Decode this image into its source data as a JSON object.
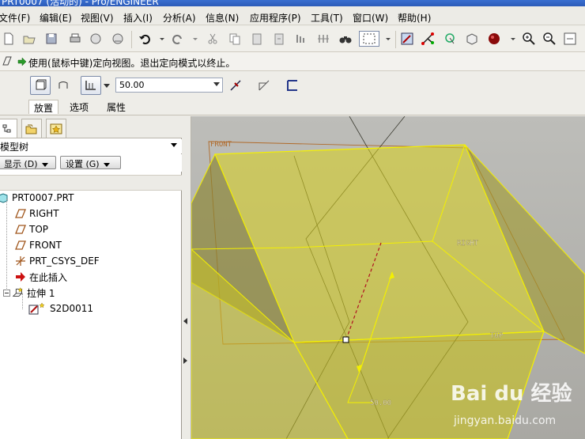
{
  "window": {
    "title": "PRT0007 (活动的) - Pro/ENGINEER"
  },
  "menu": {
    "items": [
      {
        "label": "文件(F)"
      },
      {
        "label": "编辑(E)"
      },
      {
        "label": "视图(V)"
      },
      {
        "label": "插入(I)"
      },
      {
        "label": "分析(A)"
      },
      {
        "label": "信息(N)"
      },
      {
        "label": "应用程序(P)"
      },
      {
        "label": "工具(T)"
      },
      {
        "label": "窗口(W)"
      },
      {
        "label": "帮助(H)"
      }
    ]
  },
  "message": {
    "text": "使用(鼠标中键)定向视图。退出定向模式以终止。"
  },
  "dashboard": {
    "depth_value": "50.00",
    "tabs": [
      {
        "label": "放置"
      },
      {
        "label": "选项"
      },
      {
        "label": "属性"
      }
    ]
  },
  "model_tree": {
    "header": "模型树",
    "show_button": "显示 (D)",
    "settings_button": "设置 (G)",
    "items": [
      {
        "label": "PRT0007.PRT",
        "icon": "part-icon"
      },
      {
        "label": "RIGHT",
        "icon": "datum-plane-icon"
      },
      {
        "label": "TOP",
        "icon": "datum-plane-icon"
      },
      {
        "label": "FRONT",
        "icon": "datum-plane-icon"
      },
      {
        "label": "PRT_CSYS_DEF",
        "icon": "csys-icon"
      },
      {
        "label": "在此插入",
        "icon": "insert-here-arrow-icon"
      },
      {
        "label": "拉伸 1",
        "icon": "extrude-icon"
      },
      {
        "label": "S2D0011",
        "icon": "sketch-icon"
      }
    ]
  },
  "viewport": {
    "plane_labels": {
      "front": "FRONT",
      "right": "RIGHT",
      "top": "TOP"
    },
    "dimension_label": "50.00"
  },
  "watermark": {
    "brand": "Bai du 经验",
    "url": "jingyan.baidu.com"
  },
  "colors": {
    "feature_fill": "#d8d21c",
    "feature_edge": "#f4f000",
    "datum_orange": "#b06a2a",
    "insert_arrow": "#cc1111"
  }
}
